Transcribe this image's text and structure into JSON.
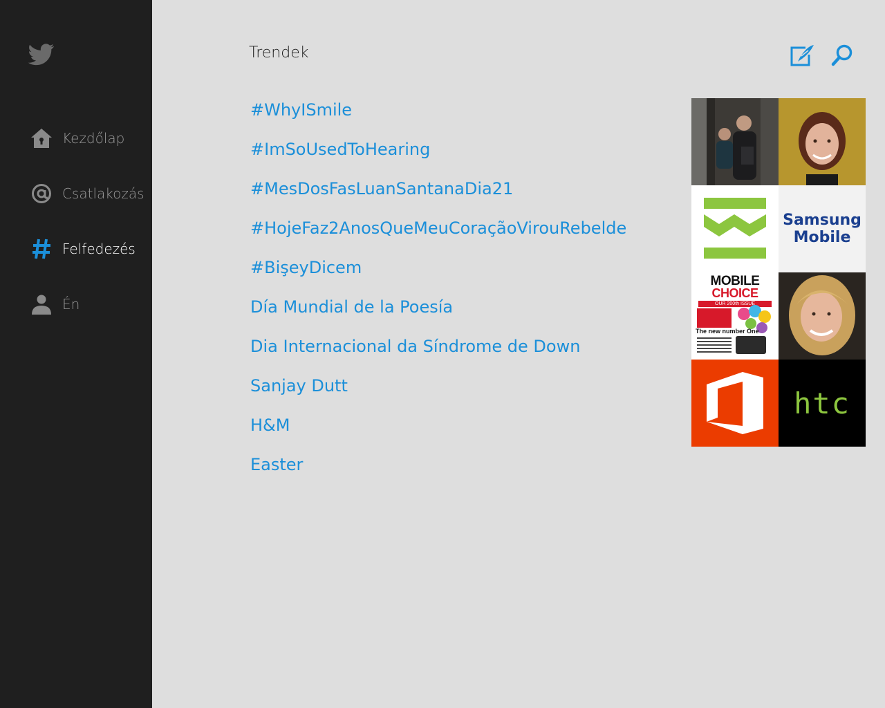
{
  "app": {
    "logo_icon": "twitter-bird-icon"
  },
  "sidebar": {
    "items": [
      {
        "label": "Kezdőlap",
        "icon": "home-icon",
        "active": false
      },
      {
        "label": "Csatlakozás",
        "icon": "at-sign-icon",
        "active": false
      },
      {
        "label": "Felfedezés",
        "icon": "hashtag-icon",
        "active": true
      },
      {
        "label": "Én",
        "icon": "person-icon",
        "active": false
      }
    ]
  },
  "main": {
    "title": "Trendek",
    "compose_icon": "compose-tweet-icon",
    "search_icon": "search-icon",
    "trends": [
      "#WhyISmile",
      "#ImSoUsedToHearing",
      "#MesDosFasLuanSantanaDia21",
      "#HojeFaz2AnosQueMeuCoraçãoVirouRebelde",
      "#BişeyDicem",
      "Día Mundial de la Poesía",
      "Dia Internacional da Síndrome de Down",
      "Sanjay Dutt",
      "H&M",
      "Easter"
    ],
    "tiles": {
      "samsung_line1": "Samsung",
      "samsung_line2": "Mobile",
      "mobile_choice_line1": "MOBILE",
      "mobile_choice_line2": "CHOICE",
      "mobile_choice_tag": "OUR 200th ISSUE",
      "mobile_choice_headline": "The new number One",
      "htc": "htc"
    }
  },
  "colors": {
    "sidebar_bg": "#1f1f1f",
    "main_bg": "#dedede",
    "accent": "#1b8fd9",
    "office_orange": "#eb3c00",
    "htc_green": "#8dc63f",
    "samsung_blue": "#1a3f8f"
  }
}
